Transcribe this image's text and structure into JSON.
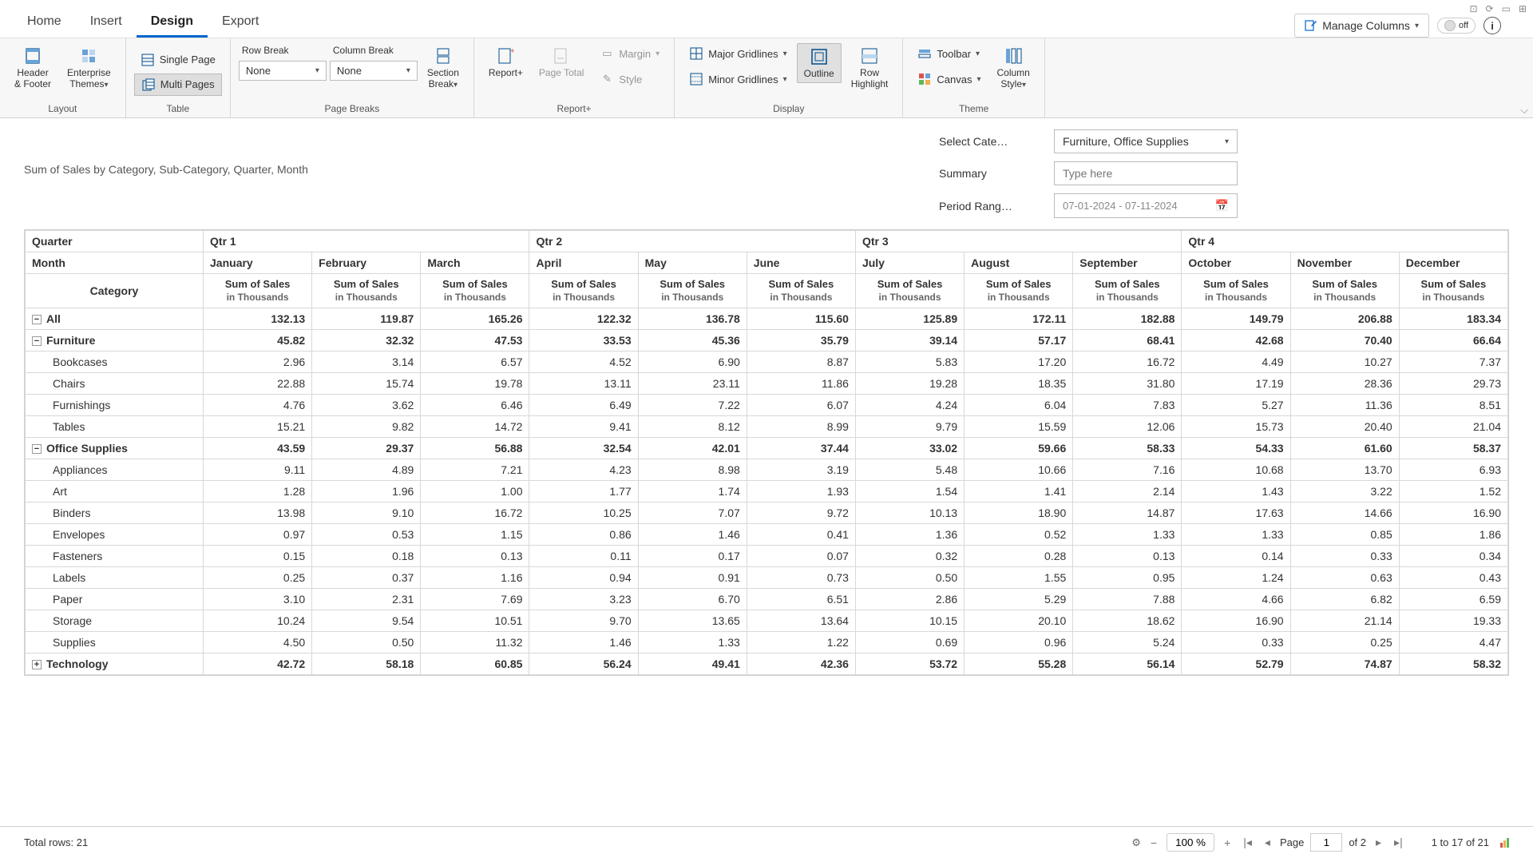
{
  "tabs": {
    "home": "Home",
    "insert": "Insert",
    "design": "Design",
    "export": "Export"
  },
  "topbar": {
    "manage_cols": "Manage Columns",
    "off": "off",
    "info": "i"
  },
  "ribbon": {
    "layout": {
      "header_footer": "Header\n& Footer",
      "ent_themes": "Enterprise\nThemes",
      "label": "Layout"
    },
    "table": {
      "single": "Single Page",
      "multi": "Multi Pages",
      "label": "Table"
    },
    "breaks": {
      "row": "Row Break",
      "col": "Column Break",
      "none": "None",
      "section": "Section\nBreak",
      "label": "Page Breaks"
    },
    "report": {
      "reportp": "Report+",
      "pagetotal": "Page Total",
      "margin": "Margin",
      "style": "Style",
      "label": "Report+"
    },
    "display": {
      "major": "Major Gridlines",
      "minor": "Minor Gridlines",
      "outline": "Outline",
      "rowhl": "Row\nHighlight",
      "label": "Display"
    },
    "theme": {
      "toolbar": "Toolbar",
      "canvas": "Canvas",
      "colstyle": "Column\nStyle",
      "label": "Theme"
    }
  },
  "report_title": "Sum of Sales by Category, Sub-Category, Quarter, Month",
  "filters": {
    "cat_lbl": "Select Cate…",
    "cat_val": "Furniture, Office Supplies",
    "sum_lbl": "Summary",
    "sum_ph": "Type here",
    "period_lbl": "Period Rang…",
    "period_val": "07-01-2024 - 07-11-2024"
  },
  "headers": {
    "quarter_lbl": "Quarter",
    "month_lbl": "Month",
    "cat_lbl": "Category",
    "quarters": [
      "Qtr 1",
      "Qtr 2",
      "Qtr 3",
      "Qtr 4"
    ],
    "months": [
      "January",
      "February",
      "March",
      "April",
      "May",
      "June",
      "July",
      "August",
      "September",
      "October",
      "November",
      "December"
    ],
    "measure": "Sum of Sales",
    "measure_sub": "in Thousands"
  },
  "rows": [
    {
      "lvl": 0,
      "exp": "−",
      "name": "All",
      "b": true,
      "v": [
        "132.13",
        "119.87",
        "165.26",
        "122.32",
        "136.78",
        "115.60",
        "125.89",
        "172.11",
        "182.88",
        "149.79",
        "206.88",
        "183.34"
      ]
    },
    {
      "lvl": 0,
      "exp": "−",
      "name": "Furniture",
      "b": true,
      "v": [
        "45.82",
        "32.32",
        "47.53",
        "33.53",
        "45.36",
        "35.79",
        "39.14",
        "57.17",
        "68.41",
        "42.68",
        "70.40",
        "66.64"
      ]
    },
    {
      "lvl": 1,
      "name": "Bookcases",
      "v": [
        "2.96",
        "3.14",
        "6.57",
        "4.52",
        "6.90",
        "8.87",
        "5.83",
        "17.20",
        "16.72",
        "4.49",
        "10.27",
        "7.37"
      ]
    },
    {
      "lvl": 1,
      "name": "Chairs",
      "v": [
        "22.88",
        "15.74",
        "19.78",
        "13.11",
        "23.11",
        "11.86",
        "19.28",
        "18.35",
        "31.80",
        "17.19",
        "28.36",
        "29.73"
      ]
    },
    {
      "lvl": 1,
      "name": "Furnishings",
      "v": [
        "4.76",
        "3.62",
        "6.46",
        "6.49",
        "7.22",
        "6.07",
        "4.24",
        "6.04",
        "7.83",
        "5.27",
        "11.36",
        "8.51"
      ]
    },
    {
      "lvl": 1,
      "name": "Tables",
      "v": [
        "15.21",
        "9.82",
        "14.72",
        "9.41",
        "8.12",
        "8.99",
        "9.79",
        "15.59",
        "12.06",
        "15.73",
        "20.40",
        "21.04"
      ]
    },
    {
      "lvl": 0,
      "exp": "−",
      "name": "Office Supplies",
      "b": true,
      "v": [
        "43.59",
        "29.37",
        "56.88",
        "32.54",
        "42.01",
        "37.44",
        "33.02",
        "59.66",
        "58.33",
        "54.33",
        "61.60",
        "58.37"
      ]
    },
    {
      "lvl": 1,
      "name": "Appliances",
      "v": [
        "9.11",
        "4.89",
        "7.21",
        "4.23",
        "8.98",
        "3.19",
        "5.48",
        "10.66",
        "7.16",
        "10.68",
        "13.70",
        "6.93"
      ]
    },
    {
      "lvl": 1,
      "name": "Art",
      "v": [
        "1.28",
        "1.96",
        "1.00",
        "1.77",
        "1.74",
        "1.93",
        "1.54",
        "1.41",
        "2.14",
        "1.43",
        "3.22",
        "1.52"
      ]
    },
    {
      "lvl": 1,
      "name": "Binders",
      "v": [
        "13.98",
        "9.10",
        "16.72",
        "10.25",
        "7.07",
        "9.72",
        "10.13",
        "18.90",
        "14.87",
        "17.63",
        "14.66",
        "16.90"
      ]
    },
    {
      "lvl": 1,
      "name": "Envelopes",
      "v": [
        "0.97",
        "0.53",
        "1.15",
        "0.86",
        "1.46",
        "0.41",
        "1.36",
        "0.52",
        "1.33",
        "1.33",
        "0.85",
        "1.86"
      ]
    },
    {
      "lvl": 1,
      "name": "Fasteners",
      "v": [
        "0.15",
        "0.18",
        "0.13",
        "0.11",
        "0.17",
        "0.07",
        "0.32",
        "0.28",
        "0.13",
        "0.14",
        "0.33",
        "0.34"
      ]
    },
    {
      "lvl": 1,
      "name": "Labels",
      "v": [
        "0.25",
        "0.37",
        "1.16",
        "0.94",
        "0.91",
        "0.73",
        "0.50",
        "1.55",
        "0.95",
        "1.24",
        "0.63",
        "0.43"
      ]
    },
    {
      "lvl": 1,
      "name": "Paper",
      "v": [
        "3.10",
        "2.31",
        "7.69",
        "3.23",
        "6.70",
        "6.51",
        "2.86",
        "5.29",
        "7.88",
        "4.66",
        "6.82",
        "6.59"
      ]
    },
    {
      "lvl": 1,
      "name": "Storage",
      "v": [
        "10.24",
        "9.54",
        "10.51",
        "9.70",
        "13.65",
        "13.64",
        "10.15",
        "20.10",
        "18.62",
        "16.90",
        "21.14",
        "19.33"
      ]
    },
    {
      "lvl": 1,
      "name": "Supplies",
      "v": [
        "4.50",
        "0.50",
        "11.32",
        "1.46",
        "1.33",
        "1.22",
        "0.69",
        "0.96",
        "5.24",
        "0.33",
        "0.25",
        "4.47"
      ]
    },
    {
      "lvl": 0,
      "exp": "+",
      "name": "Technology",
      "b": true,
      "v": [
        "42.72",
        "58.18",
        "60.85",
        "56.24",
        "49.41",
        "42.36",
        "53.72",
        "55.28",
        "56.14",
        "52.79",
        "74.87",
        "58.32"
      ]
    }
  ],
  "footer": {
    "total_rows": "Total rows: 21",
    "zoom": "100 %",
    "page_lbl": "Page",
    "page": "1",
    "of": "of 2",
    "range": "1 to 17 of 21"
  }
}
